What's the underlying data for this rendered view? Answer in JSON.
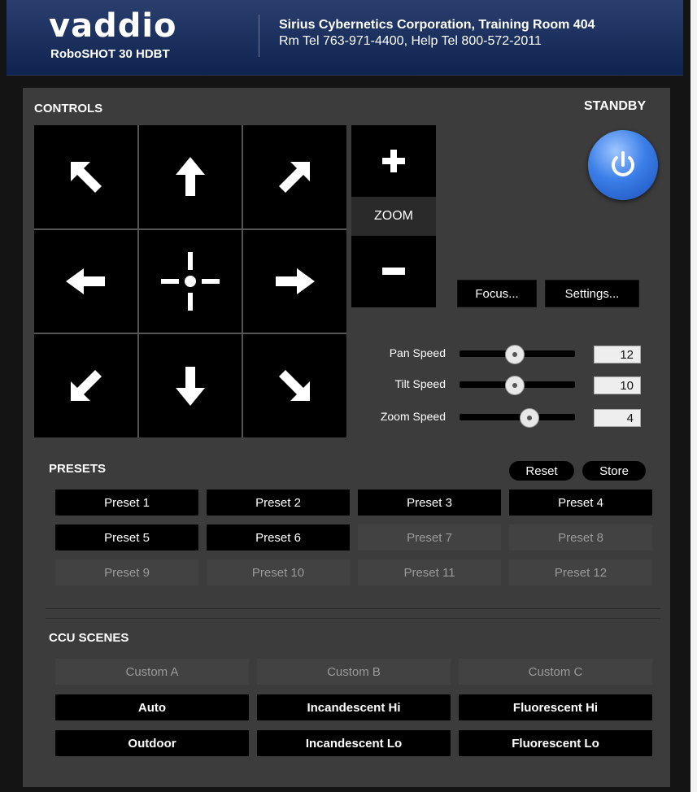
{
  "header": {
    "logo": "vaddio",
    "model": "RoboSHOT 30 HDBT",
    "line1": "Sirius Cybernetics Corporation, Training Room 404",
    "line2": "Rm Tel 763-971-4400, Help Tel 800-572-2011",
    "bg_color": "#0f2350"
  },
  "controls": {
    "title": "CONTROLS",
    "dpad": [
      {
        "name": "pan-up-left",
        "icon": "arrow-up-left-icon"
      },
      {
        "name": "tilt-up",
        "icon": "arrow-up-icon"
      },
      {
        "name": "pan-up-right",
        "icon": "arrow-up-right-icon"
      },
      {
        "name": "pan-left",
        "icon": "arrow-left-icon"
      },
      {
        "name": "home",
        "icon": "crosshair-icon"
      },
      {
        "name": "pan-right",
        "icon": "arrow-right-icon"
      },
      {
        "name": "pan-down-left",
        "icon": "arrow-down-left-icon"
      },
      {
        "name": "tilt-down",
        "icon": "arrow-down-icon"
      },
      {
        "name": "pan-down-right",
        "icon": "arrow-down-right-icon"
      }
    ],
    "zoom_label": "ZOOM",
    "zoom_in_icon": "plus-icon",
    "zoom_out_icon": "minus-icon",
    "standby_label": "STANDBY",
    "standby_icon": "power-icon",
    "focus_label": "Focus...",
    "settings_label": "Settings...",
    "speeds": [
      {
        "label": "Pan Speed",
        "value": "12",
        "level": 0.47
      },
      {
        "label": "Tilt Speed",
        "value": "10",
        "level": 0.47
      },
      {
        "label": "Zoom Speed",
        "value": "4",
        "level": 0.6
      }
    ]
  },
  "presets": {
    "title": "PRESETS",
    "reset_label": "Reset",
    "store_label": "Store",
    "items": [
      {
        "label": "Preset 1",
        "active": true
      },
      {
        "label": "Preset 2",
        "active": true
      },
      {
        "label": "Preset 3",
        "active": true
      },
      {
        "label": "Preset 4",
        "active": true
      },
      {
        "label": "Preset 5",
        "active": true
      },
      {
        "label": "Preset 6",
        "active": true
      },
      {
        "label": "Preset 7",
        "active": false
      },
      {
        "label": "Preset 8",
        "active": false
      },
      {
        "label": "Preset 9",
        "active": false
      },
      {
        "label": "Preset 10",
        "active": false
      },
      {
        "label": "Preset 11",
        "active": false
      },
      {
        "label": "Preset 12",
        "active": false
      }
    ]
  },
  "ccu": {
    "title": "CCU SCENES",
    "items": [
      {
        "label": "Custom A",
        "active": false
      },
      {
        "label": "Custom B",
        "active": false
      },
      {
        "label": "Custom C",
        "active": false
      },
      {
        "label": "Auto",
        "active": true
      },
      {
        "label": "Incandescent Hi",
        "active": true
      },
      {
        "label": "Fluorescent Hi",
        "active": true
      },
      {
        "label": "Outdoor",
        "active": true
      },
      {
        "label": "Incandescent Lo",
        "active": true
      },
      {
        "label": "Fluorescent Lo",
        "active": true
      }
    ]
  }
}
